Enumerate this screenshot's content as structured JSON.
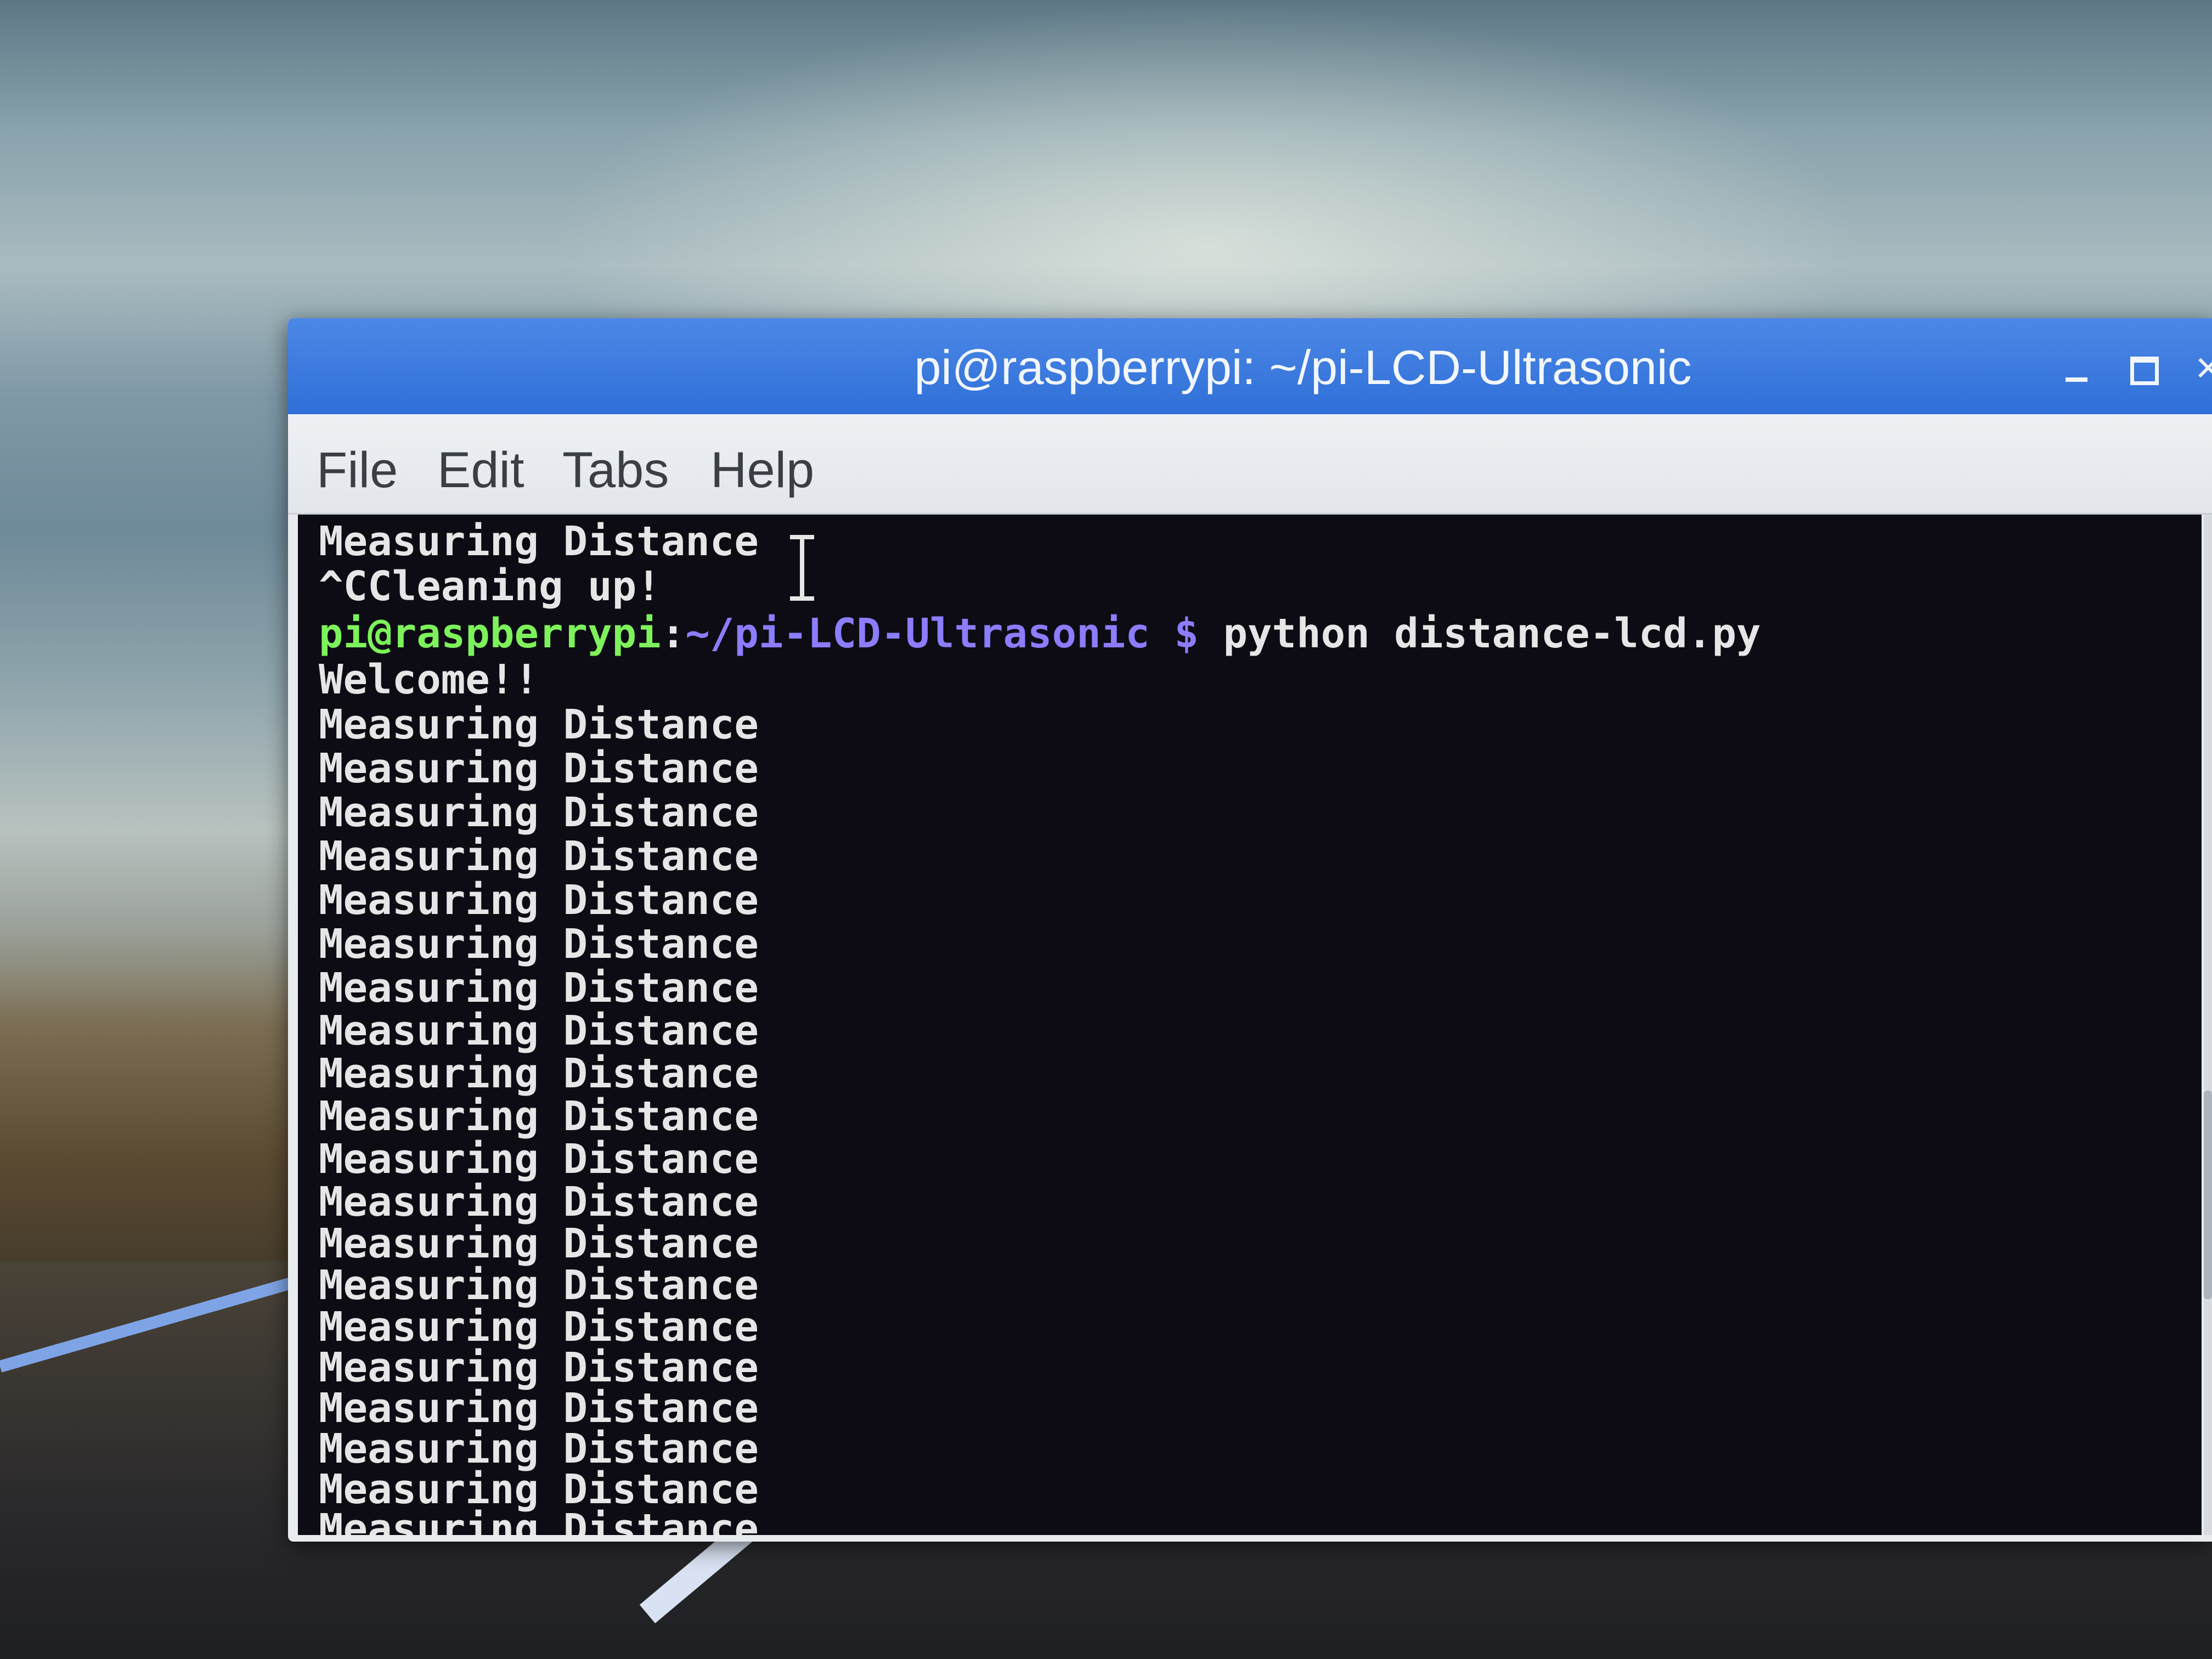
{
  "window": {
    "title": "pi@raspberrypi: ~/pi-LCD-Ultrasonic",
    "controls": {
      "close_glyph": "×"
    }
  },
  "menu": {
    "file": "File",
    "edit": "Edit",
    "tabs": "Tabs",
    "help": "Help"
  },
  "terminal": {
    "line_0": "Measuring Distance",
    "line_1": "^CCleaning up!",
    "prompt": {
      "user": "pi@raspberrypi",
      "colon": ":",
      "path": "~/pi-LCD-Ultrasonic",
      "dollar": " $",
      "command": " python distance-lcd.py"
    },
    "welcome": "Welcome!!",
    "output": [
      "Measuring Distance",
      "Measuring Distance",
      "Measuring Distance",
      "Measuring Distance",
      "Measuring Distance",
      "Measuring Distance",
      "Measuring Distance",
      "Measuring Distance",
      "Measuring Distance",
      "Measuring Distance",
      "Measuring Distance",
      "Measuring Distance",
      "Measuring Distance",
      "Measuring Distance",
      "Measuring Distance",
      "Measuring Distance",
      "Measuring Distance",
      "Measuring Distance",
      "Measuring Distance",
      "Measuring Distance"
    ]
  },
  "colors": {
    "titlebar": "#3a78de",
    "terminal_bg": "#0d0c14",
    "prompt_user": "#7df25b",
    "prompt_path": "#8c7cff",
    "text": "#e6e6e6"
  },
  "icons": {
    "minimize": "minimize-icon",
    "maximize": "maximize-icon",
    "close": "close-icon",
    "text_cursor": "i-beam-cursor-icon"
  }
}
